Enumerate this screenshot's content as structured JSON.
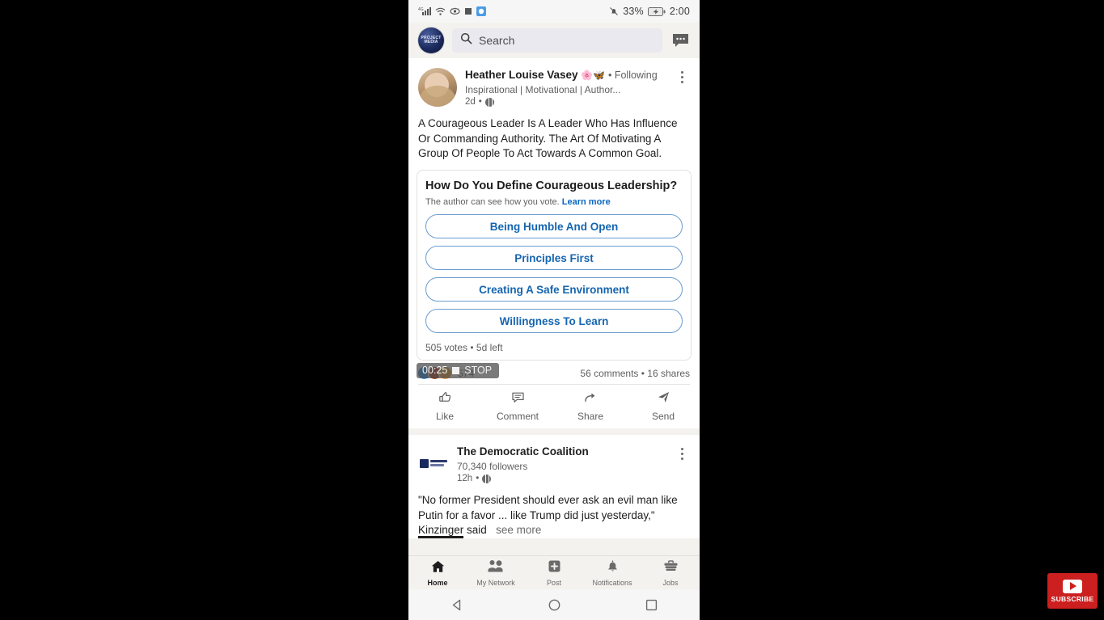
{
  "status_bar": {
    "signal_label": "4G",
    "icons_left": [
      "signal-bars-icon",
      "wifi-icon",
      "eye-icon",
      "square-icon",
      "app-badge-icon"
    ],
    "mute_icon": "bell-muted-icon",
    "battery_percent": "33%",
    "time": "2:00"
  },
  "top_bar": {
    "avatar_text": "PROJECT MEDIA",
    "search_placeholder": "Search",
    "messaging_icon": "chat-bubble-icon"
  },
  "posts": [
    {
      "author": "Heather Louise Vasey",
      "author_emoji": "🌸🦋",
      "follow_state": "• Following",
      "headline": "Inspirational | Motivational | Author...",
      "time": "2d",
      "visibility_icon": "globe-icon",
      "body": "A Courageous Leader Is A Leader Who Has Influence Or Commanding Authority. The Art Of Motivating A Group Of People To Act Towards A Common Goal.",
      "poll": {
        "question": "How Do You Define Courageous Leadership?",
        "note": "The author can see how you vote.",
        "note_link": "Learn more",
        "options": [
          "Being Humble And Open",
          "Principles First",
          "Creating A Safe Environment",
          "Willingness To Learn"
        ],
        "footer": "505 votes • 5d left"
      },
      "reaction_count": "574",
      "counts": "56 comments • 16 shares",
      "actions": [
        {
          "label": "Like",
          "icon": "thumbs-up-icon"
        },
        {
          "label": "Comment",
          "icon": "comment-bubble-icon"
        },
        {
          "label": "Share",
          "icon": "share-arrow-icon"
        },
        {
          "label": "Send",
          "icon": "send-paper-plane-icon"
        }
      ]
    },
    {
      "author": "The Democratic Coalition",
      "followers": "70,340 followers",
      "time": "12h",
      "visibility_icon": "globe-icon",
      "body_line1": "\"No former President should ever ask an evil man like",
      "body_line2": "Putin for a favor ... like Trump did just yesterday,\"",
      "body_line3_highlight": "Kinzinger",
      "body_line3_rest": " said",
      "see_more": "see more"
    }
  ],
  "screen_recorder": {
    "elapsed": "00:25",
    "stop_label": "STOP",
    "stop_icon": "stop-square-icon"
  },
  "bottom_nav": [
    {
      "label": "Home",
      "icon": "home-icon",
      "active": true
    },
    {
      "label": "My Network",
      "icon": "people-icon",
      "active": false
    },
    {
      "label": "Post",
      "icon": "plus-square-icon",
      "active": false
    },
    {
      "label": "Notifications",
      "icon": "bell-icon",
      "active": false
    },
    {
      "label": "Jobs",
      "icon": "briefcase-icon",
      "active": false
    }
  ],
  "system_nav": [
    {
      "icon": "back-triangle-icon"
    },
    {
      "icon": "home-circle-icon"
    },
    {
      "icon": "recents-square-icon"
    }
  ],
  "watermark": {
    "label": "SUBSCRIBE",
    "icon": "youtube-play-icon"
  },
  "colors": {
    "brand_blue": "#0a66c2",
    "poll_text": "#1565b0",
    "feed_bg": "#f4f2ee",
    "watermark_red": "#cc1f1f"
  }
}
